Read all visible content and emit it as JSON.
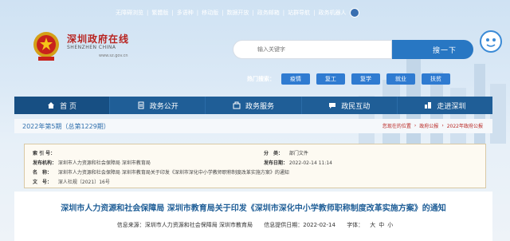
{
  "toplinks": [
    "无障碍浏览",
    "繁體版",
    "多语种",
    "移动版",
    "数据开放",
    "政务邮箱",
    "站群导航",
    "政务机器人"
  ],
  "header": {
    "logo_cn": "深圳政府在线",
    "logo_en": "SHENZHEN CHINA",
    "logo_url": "www.sz.gov.cn",
    "search_placeholder": "输入关键字",
    "search_button": "搜一下"
  },
  "hot": {
    "label": "热门搜索：",
    "tags": [
      "疫情",
      "复工",
      "复学",
      "就业",
      "扶贫"
    ]
  },
  "nav": {
    "items": [
      {
        "label": "首 页",
        "icon": "home-icon"
      },
      {
        "label": "政务公开",
        "icon": "document-icon"
      },
      {
        "label": "政务服务",
        "icon": "service-icon"
      },
      {
        "label": "政民互动",
        "icon": "chat-icon"
      },
      {
        "label": "走进深圳",
        "icon": "city-icon"
      }
    ]
  },
  "issue": {
    "title": "2022年第5期（总第1229期）",
    "breadcrumb_prefix": "您现在的位置",
    "breadcrumb": [
      "政府公报",
      "2022年政府公报"
    ]
  },
  "info": {
    "index_k": "索 引 号：",
    "index_v": "",
    "category_k": "分　类：",
    "category_v": "部门文件",
    "issuer_k": "发布机构：",
    "issuer_v": "深圳市人力资源和社会保障局 深圳市教育局",
    "date_k": "发布日期：",
    "date_v": "2022-02-14 11:14",
    "name_k": "名　称：",
    "name_v": "深圳市人力资源和社会保障局 深圳市教育局关于印发《深圳市深化中小学教师职称制度改革实施方案》的通知",
    "docno_k": "文　号：",
    "docno_v": "深人社规〔2021〕16号"
  },
  "article": {
    "title": "深圳市人力资源和社会保障局 深圳市教育局关于印发《深圳市深化中小学教师职称制度改革实施方案》的通知",
    "source": "信息来源：深圳市人力资源和社会保障局 深圳市教育局",
    "date": "信息提供日期：2022-02-14",
    "font_label": "字体：",
    "font_sizes": [
      "大",
      "中",
      "小"
    ]
  }
}
